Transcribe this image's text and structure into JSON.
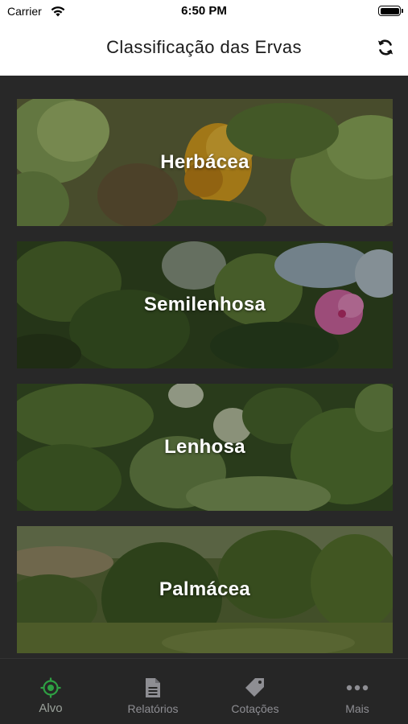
{
  "status_bar": {
    "carrier": "Carrier",
    "time": "6:50 PM",
    "wifi_icon": "wifi-icon",
    "battery_icon": "battery-icon"
  },
  "nav": {
    "title": "Classificação das Ervas",
    "refresh_icon": "refresh-icon"
  },
  "cards": [
    {
      "label": "Herbácea"
    },
    {
      "label": "Semilenhosa"
    },
    {
      "label": "Lenhosa"
    },
    {
      "label": "Palmácea"
    }
  ],
  "tabs": [
    {
      "label": "Alvo",
      "icon": "target-icon",
      "active": true
    },
    {
      "label": "Relatórios",
      "icon": "document-icon",
      "active": false
    },
    {
      "label": "Cotações",
      "icon": "tag-icon",
      "active": false
    },
    {
      "label": "Mais",
      "icon": "more-icon",
      "active": false
    }
  ],
  "colors": {
    "accent": "#2ea043",
    "tab_inactive": "#8e8e93",
    "background": "#282828"
  }
}
